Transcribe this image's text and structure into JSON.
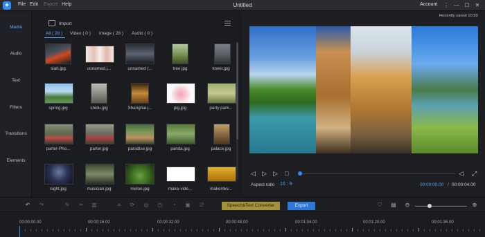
{
  "titlebar": {
    "menus": [
      "File",
      "Edit",
      "Export",
      "Help"
    ],
    "title": "Untitled",
    "account": "Account"
  },
  "nav": {
    "items": [
      "Media",
      "Audio",
      "Text",
      "Filters",
      "Transitions",
      "Elements"
    ],
    "active": "Media"
  },
  "media": {
    "import_label": "Import",
    "tabs": [
      "All ( 28 )",
      "Video ( 0 )",
      "Image ( 28 )",
      "Audio ( 0 )"
    ],
    "items": [
      "siah.jpg",
      "unnamed.j...",
      "unnamed (...",
      "tree.jpg",
      "tower.jpg",
      "spring.jpg",
      "shidu.jpg",
      "Shanghai.j...",
      "pig.jpg",
      "party park...",
      "parter-Pho...",
      "parter.jpg",
      "paradise.jpg",
      "panda.jpg",
      "palace.jpg",
      "night.jpg",
      "musician.jpg",
      "melon.jpg",
      "make-vide...",
      "makemkv..."
    ]
  },
  "preview": {
    "saved_text": "Recently saved 10:59",
    "aspect_label": "Aspect ratio",
    "aspect_value": "16 : 9",
    "time_current": "00:00:00.00",
    "time_sep": "/",
    "time_total": "00:00:04.00"
  },
  "toolbar": {
    "speech_label": "Speech&Text Converter",
    "export_label": "Export"
  },
  "timeline": {
    "ticks": [
      "00:00:00.00",
      "00:00:16.00",
      "00:00:32.00",
      "00:00:48.00",
      "00:01:04.00",
      "00:01:20.00",
      "00:01:36.00"
    ]
  },
  "colors": {
    "accent": "#2f8df5",
    "speech_button": "#a3933a",
    "export_button": "#2f77d8"
  }
}
